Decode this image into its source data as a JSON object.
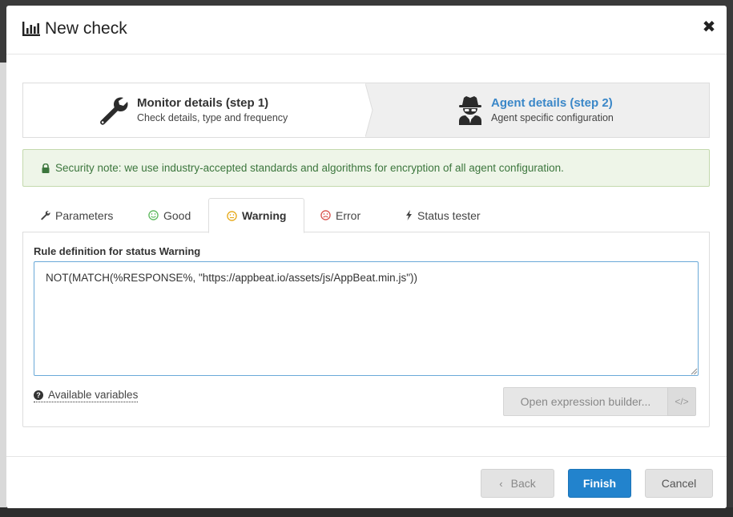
{
  "dialog": {
    "title": "New check",
    "close_symbol": "✖"
  },
  "steps": [
    {
      "title": "Monitor details (step 1)",
      "subtitle": "Check details, type and frequency",
      "icon": "wrench-icon"
    },
    {
      "title": "Agent details (step 2)",
      "subtitle": "Agent specific configuration",
      "icon": "spy-agent-icon"
    }
  ],
  "security_note": {
    "text": "Security note: we use industry-accepted standards and algorithms for encryption of all agent configuration."
  },
  "tabs": [
    {
      "label": "Parameters",
      "icon": "wrench-icon"
    },
    {
      "label": "Good",
      "icon": "smile-icon",
      "color": "#5cb85c"
    },
    {
      "label": "Warning",
      "icon": "meh-icon",
      "color": "#e6a817"
    },
    {
      "label": "Error",
      "icon": "frown-icon",
      "color": "#d9534f"
    },
    {
      "label": "Status tester",
      "icon": "bolt-icon"
    }
  ],
  "active_tab": "Warning",
  "panel": {
    "rule_label": "Rule definition for status Warning",
    "rule_value": "NOT(MATCH(%RESPONSE%, \"https://appbeat.io/assets/js/AppBeat.min.js\"))",
    "available_variables": "Available variables",
    "expression_builder": "Open expression builder...",
    "code_symbol": "</>"
  },
  "footer": {
    "back": "Back",
    "finish": "Finish",
    "cancel": "Cancel"
  },
  "colors": {
    "accent": "#2283cd",
    "step_active": "#3a87c8",
    "success_text": "#3c763d"
  }
}
